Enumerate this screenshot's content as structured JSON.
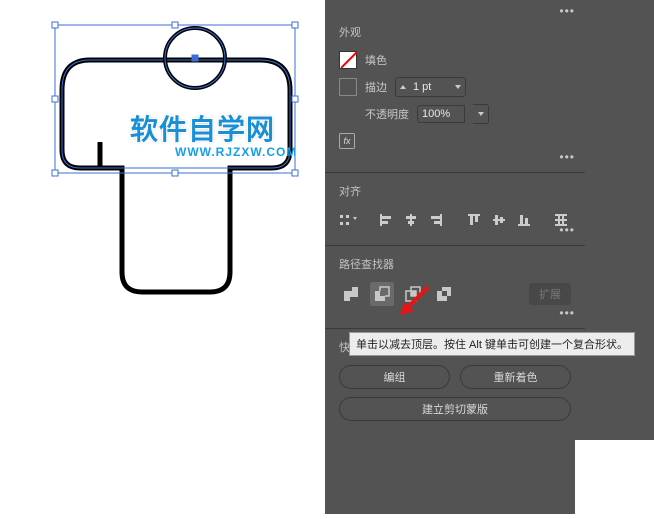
{
  "watermark": {
    "text": "软件自学网",
    "url": "WWW.RJZXW.COM"
  },
  "appearance": {
    "title": "外观",
    "fill_label": "填色",
    "stroke_label": "描边",
    "stroke_value": "1 pt",
    "opacity_label": "不透明度",
    "opacity_value": "100%"
  },
  "align": {
    "title": "对齐"
  },
  "pathfinder": {
    "title": "路径查找器",
    "expand": "扩展",
    "tooltip": "单击以减去顶层。按住 Alt 键单击可创建一个复合形状。"
  },
  "quick": {
    "title": "快速操作",
    "group": "编组",
    "recolor": "重新着色",
    "clipmask": "建立剪切蒙版"
  }
}
